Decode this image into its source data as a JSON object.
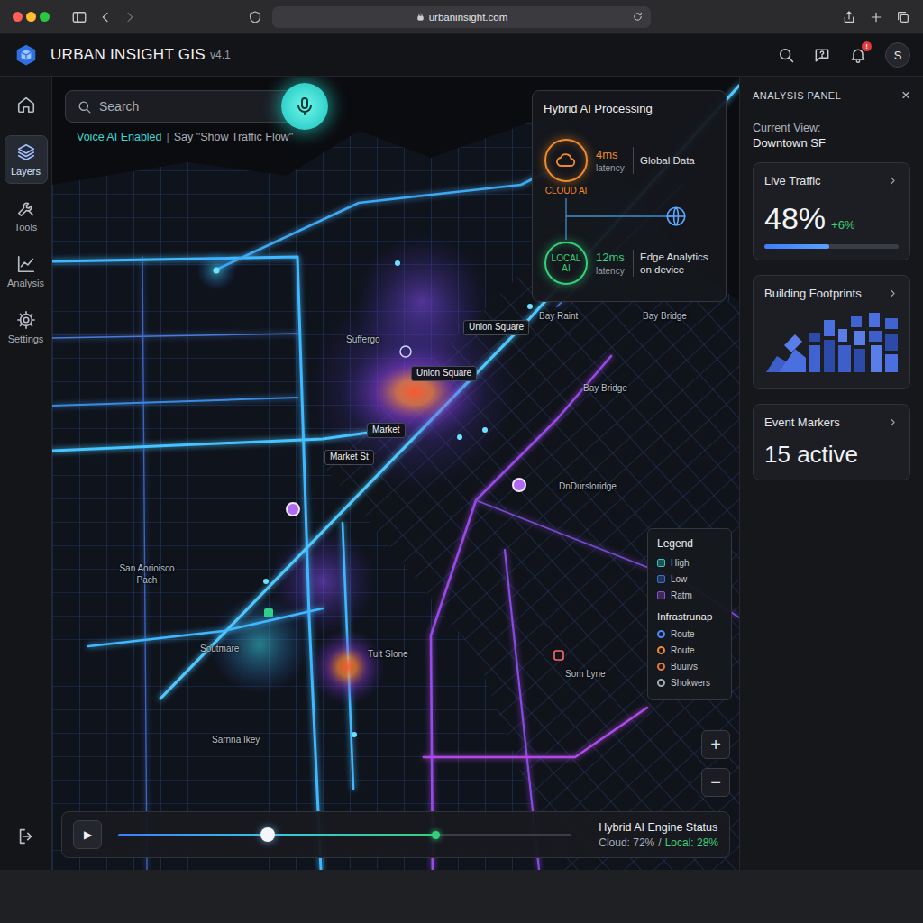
{
  "browser": {
    "url": "urbaninsight.com"
  },
  "app": {
    "title": "URBAN INSIGHT GIS",
    "version": "v4.1",
    "notification_badge": "!",
    "avatar": "S"
  },
  "nav": {
    "items": [
      {
        "label": "Layers",
        "selected": true
      },
      {
        "label": "Tools",
        "selected": false
      },
      {
        "label": "Analysis",
        "selected": false
      },
      {
        "label": "Settings",
        "selected": false
      }
    ]
  },
  "search": {
    "placeholder": "Search"
  },
  "voice": {
    "status": "Voice AI Enabled",
    "separator": "|",
    "hint": "Say \"Show Traffic Flow\""
  },
  "hybrid": {
    "title": "Hybrid AI Processing",
    "nodes": [
      {
        "kind": "cloud",
        "label": "CLOUD AI",
        "latency": "4ms",
        "latency_label": "latency",
        "description": "Global Data",
        "color": "#f08a2a"
      },
      {
        "kind": "local",
        "label": "LOCAL AI",
        "latency": "12ms",
        "latency_label": "latency",
        "description": "Edge Analytics on device",
        "color": "#34d07a"
      }
    ]
  },
  "map_labels": [
    {
      "text": "Union Square",
      "kind": "boxed"
    },
    {
      "text": "Suffergo",
      "kind": "plain"
    },
    {
      "text": "Bay Raint",
      "kind": "plain"
    },
    {
      "text": "Bay Bridge",
      "kind": "plain"
    },
    {
      "text": "Union Square",
      "kind": "boxed"
    },
    {
      "text": "Bay Bridge",
      "kind": "plain"
    },
    {
      "text": "Market",
      "kind": "boxed"
    },
    {
      "text": "Market St",
      "kind": "boxed"
    },
    {
      "text": "DnDursloridge",
      "kind": "plain"
    },
    {
      "text": "San Aorioisco Pach",
      "kind": "plain"
    },
    {
      "text": "Soutmare",
      "kind": "plain"
    },
    {
      "text": "Tult Slone",
      "kind": "plain"
    },
    {
      "text": "Sarnna Ikey",
      "kind": "plain"
    },
    {
      "text": "Som Lyne",
      "kind": "plain"
    }
  ],
  "legend": {
    "title": "Legend",
    "items": [
      {
        "label": "High",
        "color": "#2fc6c6"
      },
      {
        "label": "Low",
        "color": "#3a6fd8"
      },
      {
        "label": "Ratm",
        "color": "#8a4fd8"
      }
    ],
    "infra_title": "Infrastrunap",
    "infra": [
      {
        "label": "Route",
        "color": "#4a8cff"
      },
      {
        "label": "Route",
        "color": "#f08a3a"
      },
      {
        "label": "Buuivs",
        "color": "#e07840"
      },
      {
        "label": "Shokwers",
        "color": "#a8abb2"
      }
    ]
  },
  "zoom": {
    "zoom_in": "+",
    "zoom_out": "−"
  },
  "timeline": {
    "play": "▶",
    "level": 0.33,
    "buffer": 0.7
  },
  "engine": {
    "title": "Hybrid AI Engine Status",
    "cloud": "Cloud: 72%",
    "separator": "/",
    "local": "Local: 28%"
  },
  "panel": {
    "title": "ANALYSIS PANEL",
    "close": "×",
    "current_view_label": "Current View:",
    "current_view": "Downtown SF",
    "cards": [
      {
        "kind": "metric",
        "title": "Live Traffic",
        "value": "48%",
        "delta": "+6%",
        "level": 0.48
      },
      {
        "kind": "footprints",
        "title": "Building Footprints"
      },
      {
        "kind": "count",
        "title": "Event Markers",
        "value": "15 active"
      }
    ]
  }
}
